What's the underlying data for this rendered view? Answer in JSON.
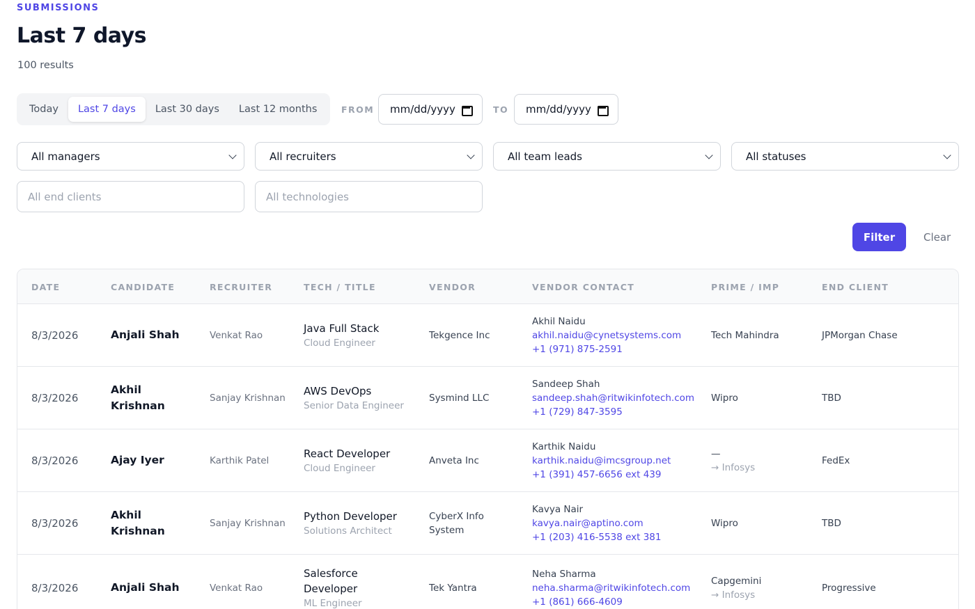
{
  "header": {
    "eyebrow": "SUBMISSIONS",
    "title": "Last 7 days",
    "results": "100 results"
  },
  "range_tabs": [
    {
      "label": "Today",
      "active": false
    },
    {
      "label": "Last 7 days",
      "active": true
    },
    {
      "label": "Last 30 days",
      "active": false
    },
    {
      "label": "Last 12 months",
      "active": false
    }
  ],
  "date_range": {
    "from_label": "FROM",
    "to_label": "TO",
    "from_value": "mm/dd/yyyy",
    "to_value": "mm/dd/yyyy"
  },
  "filters": {
    "managers": "All managers",
    "recruiters": "All recruiters",
    "team_leads": "All team leads",
    "statuses": "All statuses",
    "end_clients_placeholder": "All end clients",
    "technologies_placeholder": "All technologies",
    "filter_label": "Filter",
    "clear_label": "Clear"
  },
  "table": {
    "columns": [
      "DATE",
      "CANDIDATE",
      "RECRUITER",
      "TECH / TITLE",
      "VENDOR",
      "VENDOR CONTACT",
      "PRIME / IMP",
      "END CLIENT"
    ],
    "rows": [
      {
        "date": "8/3/2026",
        "candidate": "Anjali Shah",
        "recruiter": "Venkat Rao",
        "tech": "Java Full Stack",
        "title": "Cloud Engineer",
        "vendor": "Tekgence Inc",
        "contact_name": "Akhil Naidu",
        "contact_email": "akhil.naidu@cynetsystems.com",
        "contact_phone": "+1 (971) 875-2591",
        "prime": "Tech Mahindra",
        "imp": "",
        "end_client": "JPMorgan Chase"
      },
      {
        "date": "8/3/2026",
        "candidate": "Akhil Krishnan",
        "recruiter": "Sanjay Krishnan",
        "tech": "AWS DevOps",
        "title": "Senior Data Engineer",
        "vendor": "Sysmind LLC",
        "contact_name": "Sandeep Shah",
        "contact_email": "sandeep.shah@ritwikinfotech.com",
        "contact_phone": "+1 (729) 847-3595",
        "prime": "Wipro",
        "imp": "",
        "end_client": "TBD"
      },
      {
        "date": "8/3/2026",
        "candidate": "Ajay Iyer",
        "recruiter": "Karthik Patel",
        "tech": "React Developer",
        "title": "Cloud Engineer",
        "vendor": "Anveta Inc",
        "contact_name": "Karthik Naidu",
        "contact_email": "karthik.naidu@imcsgroup.net",
        "contact_phone": "+1 (391) 457-6656 ext 439",
        "prime": "—",
        "imp": "→ Infosys",
        "end_client": "FedEx"
      },
      {
        "date": "8/3/2026",
        "candidate": "Akhil Krishnan",
        "recruiter": "Sanjay Krishnan",
        "tech": "Python Developer",
        "title": "Solutions Architect",
        "vendor": "CyberX Info System",
        "contact_name": "Kavya Nair",
        "contact_email": "kavya.nair@aptino.com",
        "contact_phone": "+1 (203) 416-5538 ext 381",
        "prime": "Wipro",
        "imp": "",
        "end_client": "TBD"
      },
      {
        "date": "8/3/2026",
        "candidate": "Anjali Shah",
        "recruiter": "Venkat Rao",
        "tech": "Salesforce Developer",
        "title": "ML Engineer",
        "vendor": "Tek Yantra",
        "contact_name": "Neha Sharma",
        "contact_email": "neha.sharma@ritwikinfotech.com",
        "contact_phone": "+1 (861) 666-4609",
        "prime": "Capgemini",
        "imp": "→ Infosys",
        "end_client": "Progressive"
      }
    ]
  },
  "colors": {
    "accent": "#4f46e5",
    "muted": "#9ca3af",
    "border": "#e5e7eb"
  }
}
